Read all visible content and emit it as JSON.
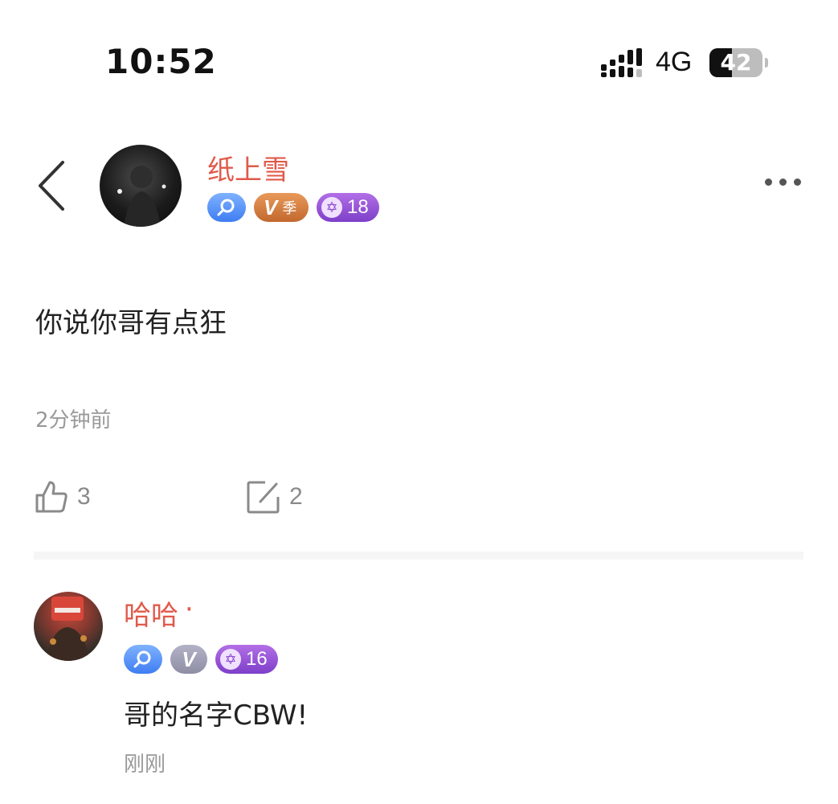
{
  "status_bar": {
    "time": "10:52",
    "network": "4G",
    "battery_level": "42",
    "battery_fraction": 0.42
  },
  "post": {
    "author": {
      "name": "纸上雪",
      "name_color": "#e05a4a",
      "badges": {
        "search_icon": "search-badge-icon",
        "vip_label": "V",
        "vip_season": "季",
        "level_icon": "star-icon",
        "level": "18"
      }
    },
    "content": "你说你哥有点狂",
    "time": "2分钟前",
    "likes": "3",
    "comments": "2"
  },
  "comment": {
    "author": {
      "name": "哈哈",
      "dot": "·",
      "badges": {
        "search_icon": "search-badge-icon",
        "vip_label": "V",
        "level_icon": "star-icon",
        "level": "16"
      }
    },
    "content": "哥的名字CBW!",
    "time": "刚刚"
  }
}
